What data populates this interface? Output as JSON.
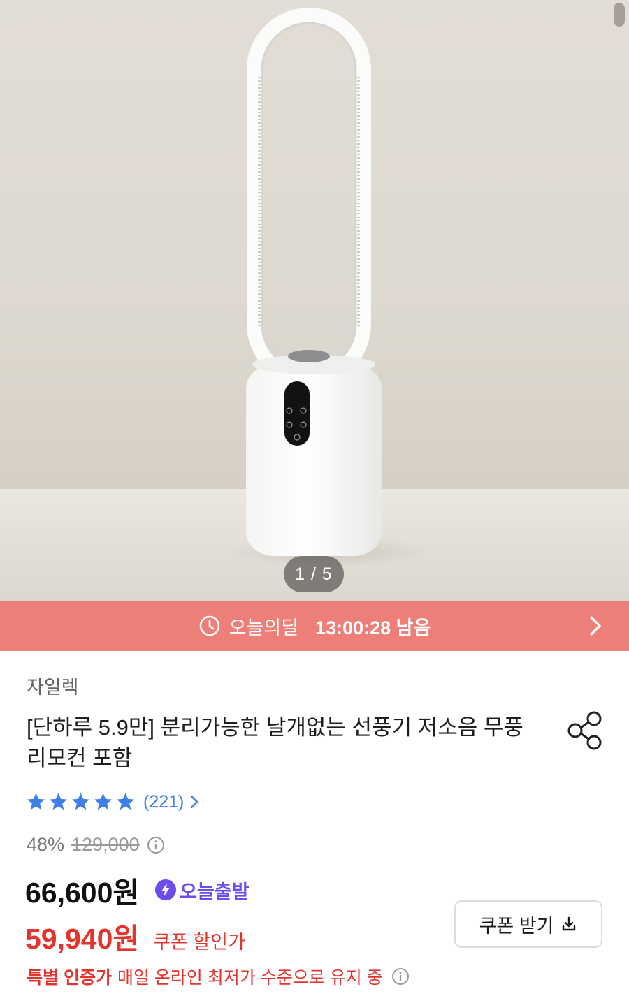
{
  "hero": {
    "counter": "1 / 5",
    "product_image": "bladeless-tower-fan-photo"
  },
  "deal_banner": {
    "label": "오늘의딜",
    "time_left": "13:00:28 남음",
    "color": "#ee7f78"
  },
  "product": {
    "brand": "자일렉",
    "title": "[단하루 5.9만] 분리가능한 날개없는 선풍기 저소음 무풍 리모컨 포함",
    "rating": {
      "stars": 5,
      "review_count": "(221)",
      "color": "#3f80e8"
    },
    "discount_rate": "48%",
    "original_price": "129,000",
    "sale_price": "66,600원",
    "today_badge": "오늘출발",
    "coupon_price": "59,940원",
    "coupon_label": "쿠폰 할인가",
    "coupon_button": "쿠폰 받기",
    "special_title": "특별 인증가",
    "special_desc": "매일 온라인 최저가 수준으로 유지 중"
  },
  "colors": {
    "accent_red": "#e4342e",
    "badge_purple": "#6a4cf0"
  }
}
